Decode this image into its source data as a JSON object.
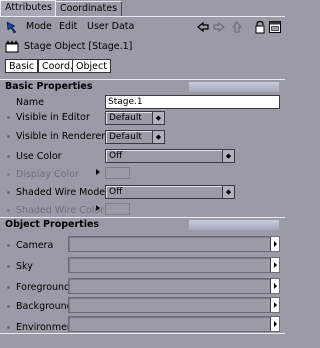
{
  "tabs": [
    "Attributes",
    "Coordinates"
  ],
  "menu": {
    "mode": "Mode",
    "edit": "Edit",
    "user_data": "User Data"
  },
  "object_title": "Stage Object [Stage.1]",
  "subtabs": [
    "Basic",
    "Coord.",
    "Object"
  ],
  "basic": {
    "header": "Basic Properties",
    "name_label": "Name",
    "name_value": "Stage.1",
    "visible_editor_label": "Visible in Editor",
    "visible_editor_value": "Default",
    "visible_renderer_label": "Visible in Renderer",
    "visible_renderer_value": "Default",
    "use_color_label": "Use Color",
    "use_color_value": "Off",
    "display_color_label": "Display Color",
    "shaded_wire_mode_label": "Shaded Wire Mode",
    "shaded_wire_mode_value": "Off",
    "shaded_wire_color_label": "Shaded Wire Color"
  },
  "object": {
    "header": "Object Properties",
    "links": [
      "Camera",
      "Sky",
      "Foreground",
      "Background",
      "Environment"
    ]
  }
}
